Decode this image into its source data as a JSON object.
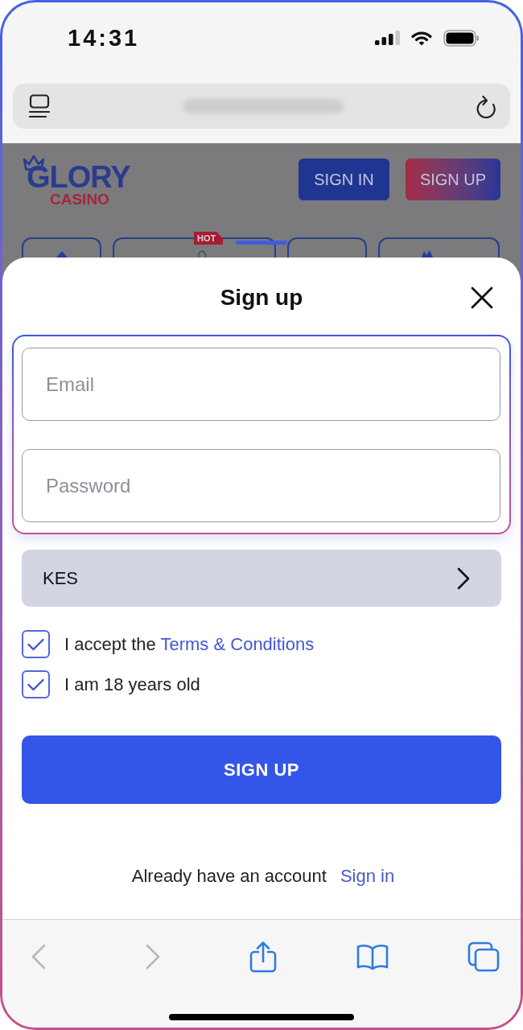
{
  "status_bar": {
    "time": "14:31"
  },
  "site_header": {
    "logo": {
      "title": "GLORY",
      "subtitle": "CASINO"
    },
    "buttons": [
      {
        "label": "SIGN IN",
        "kind": "solid"
      },
      {
        "label": "SIGN UP",
        "kind": "gradient"
      }
    ]
  },
  "category_tiles": [
    {
      "kind": "plain"
    },
    {
      "kind": "badged",
      "badge": "HOT"
    },
    {
      "kind": "plain"
    },
    {
      "kind": "plain"
    }
  ],
  "sheet": {
    "title": "Sign up",
    "fields": [
      {
        "placeholder": "Email"
      },
      {
        "placeholder": "Password"
      }
    ],
    "currency_select": {
      "value": "KES"
    },
    "checkboxes": [
      {
        "label": "I accept the",
        "link": "Terms & Conditions",
        "checked": true
      },
      {
        "label": "I am 18 years old",
        "checked": true
      }
    ],
    "submit_button": "SIGN UP",
    "footer": {
      "text": "Already have an account",
      "link": "Sign in"
    }
  },
  "toolbar": [
    {
      "kind": "back",
      "disabled": true
    },
    {
      "kind": "forward",
      "disabled": true
    },
    {
      "kind": "share",
      "disabled": false
    },
    {
      "kind": "bookmarks",
      "disabled": false
    },
    {
      "kind": "tabs",
      "disabled": false
    }
  ]
}
